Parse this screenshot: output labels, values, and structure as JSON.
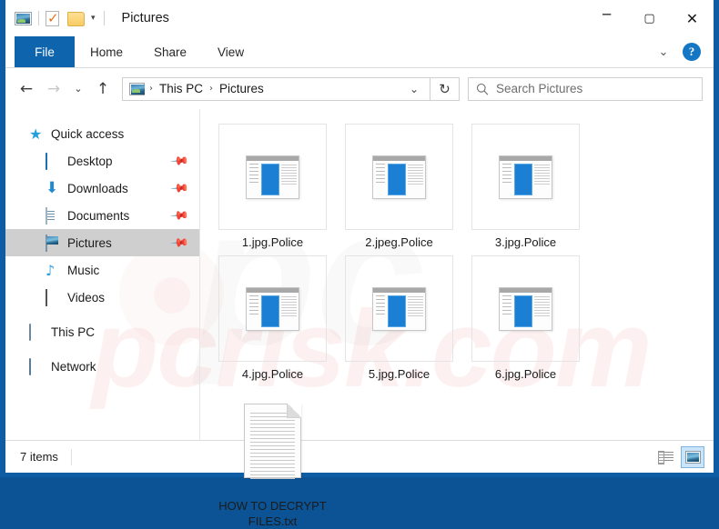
{
  "window": {
    "title": "Pictures",
    "quick_access_icons": [
      "picture-icon",
      "properties-checkmark-icon",
      "folder-icon"
    ],
    "qat_dropdown": "▾",
    "controls": {
      "minimize": "─",
      "maximize": "▢",
      "close": "✕"
    }
  },
  "ribbon": {
    "tabs": [
      {
        "label": "File",
        "active": true
      },
      {
        "label": "Home",
        "active": false
      },
      {
        "label": "Share",
        "active": false
      },
      {
        "label": "View",
        "active": false
      }
    ],
    "expand_chevron": "⌄",
    "help_label": "?"
  },
  "address_bar": {
    "back": "←",
    "forward": "→",
    "recent": "⌄",
    "up": "↑",
    "crumbs": [
      "This PC",
      "Pictures"
    ],
    "crumb_separator": "›",
    "dropdown_chevron": "⌄",
    "refresh": "↻"
  },
  "search": {
    "placeholder": "Search Pictures",
    "value": ""
  },
  "sidebar": {
    "items": [
      {
        "label": "Quick access",
        "icon": "star-icon",
        "indent": false,
        "pinned": false,
        "selected": false
      },
      {
        "label": "Desktop",
        "icon": "desktop-icon",
        "indent": true,
        "pinned": true,
        "selected": false
      },
      {
        "label": "Downloads",
        "icon": "download-icon",
        "indent": true,
        "pinned": true,
        "selected": false
      },
      {
        "label": "Documents",
        "icon": "document-icon",
        "indent": true,
        "pinned": true,
        "selected": false
      },
      {
        "label": "Pictures",
        "icon": "picture-icon",
        "indent": true,
        "pinned": true,
        "selected": true
      },
      {
        "label": "Music",
        "icon": "music-note-icon",
        "indent": true,
        "pinned": false,
        "selected": false
      },
      {
        "label": "Videos",
        "icon": "video-icon",
        "indent": true,
        "pinned": false,
        "selected": false
      },
      {
        "label": "This PC",
        "icon": "computer-icon",
        "indent": false,
        "pinned": false,
        "selected": false
      },
      {
        "label": "Network",
        "icon": "network-icon",
        "indent": false,
        "pinned": false,
        "selected": false
      }
    ],
    "pin_glyph": "📌"
  },
  "files": [
    {
      "name": "1.jpg.Police",
      "icon": "unknown-file-icon"
    },
    {
      "name": "2.jpeg.Police",
      "icon": "unknown-file-icon"
    },
    {
      "name": "3.jpg.Police",
      "icon": "unknown-file-icon"
    },
    {
      "name": "4.jpg.Police",
      "icon": "unknown-file-icon"
    },
    {
      "name": "5.jpg.Police",
      "icon": "unknown-file-icon"
    },
    {
      "name": "6.jpg.Police",
      "icon": "unknown-file-icon"
    },
    {
      "name": "HOW TO DECRYPT FILES.txt",
      "icon": "text-file-icon"
    }
  ],
  "status_bar": {
    "item_count": "7 items",
    "views": [
      {
        "name": "details-view",
        "active": false
      },
      {
        "name": "large-icons-view",
        "active": true
      }
    ]
  },
  "watermark": {
    "text": "pcrisk.com",
    "glyph": "pc"
  },
  "colors": {
    "window_border": "#0e5ca3",
    "file_tab": "#0e64ad",
    "selection": "#cfcfcf",
    "accent_blue": "#1b7fd4",
    "help_blue": "#1577c4",
    "view_active": "#cce4f7"
  }
}
